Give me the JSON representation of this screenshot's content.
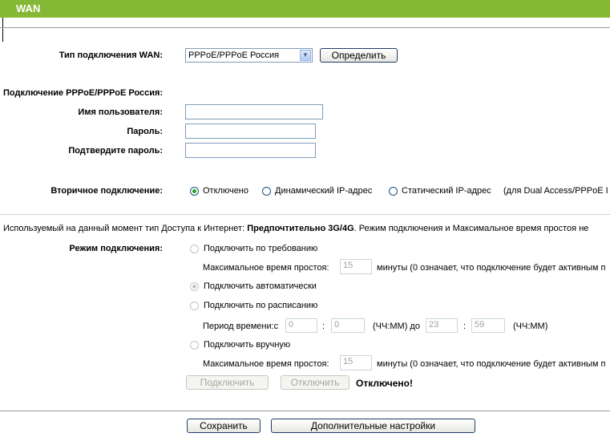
{
  "header": {
    "title": "WAN"
  },
  "wan_type": {
    "label": "Тип подключения WAN:",
    "selected": "PPPoE/PPPoE Россия",
    "detect_button": "Определить"
  },
  "pppoe": {
    "section_title": "Подключение PPPoE/PPPoE Россия:",
    "username_label": "Имя пользователя:",
    "username_value": "",
    "password_label": "Пароль:",
    "password_value": "",
    "confirm_label": "Подтвердите пароль:",
    "confirm_value": ""
  },
  "secondary": {
    "label": "Вторичное подключение:",
    "options": [
      "Отключено",
      "Динамический IP-адрес",
      "Статический IP-адрес"
    ],
    "selected_index": 0,
    "note": "(для Dual Access/PPPoE I"
  },
  "info": {
    "prefix": "Используемый на данный момент тип Доступа к Интернет: ",
    "highlight": "Предпочтительно 3G/4G",
    "suffix": ". Режим подключения и Максимальное время простоя не"
  },
  "mode": {
    "label": "Режим подключения:",
    "on_demand": "Подключить по требованию",
    "idle_label_1": "Максимальное время простоя:",
    "idle_value_1": "15",
    "idle_note_1": "минуты (0 означает, что подключение будет активным п",
    "auto": "Подключить автоматически",
    "schedule": "Подключить по расписанию",
    "period_label": "Период времени:с",
    "from_h": "0",
    "from_m": "0",
    "hhmm_1": "(ЧЧ:ММ) до",
    "to_h": "23",
    "to_m": "59",
    "hhmm_2": "(ЧЧ:ММ)",
    "manual": "Подключить вручную",
    "idle_label_2": "Максимальное время простоя:",
    "idle_value_2": "15",
    "idle_note_2": "минуты (0 означает, что подключение будет активным п",
    "connect_button": "Подключить",
    "disconnect_button": "Отключить",
    "status": "Отключено!"
  },
  "footer": {
    "save_button": "Сохранить",
    "advanced_button": "Дополнительные настройки"
  },
  "colors": {
    "header_bg": "#85b834",
    "radio_on": "#21a121"
  }
}
